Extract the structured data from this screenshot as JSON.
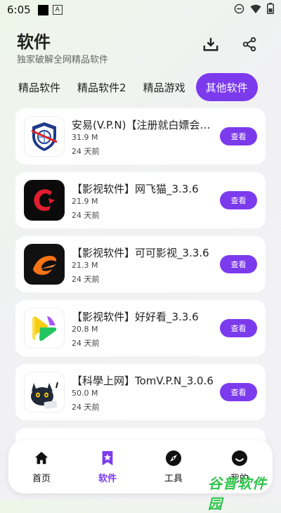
{
  "status": {
    "time": "6:05"
  },
  "header": {
    "title": "软件",
    "subtitle": "独家破解全网精品软件"
  },
  "tabs": [
    {
      "label": "精品软件"
    },
    {
      "label": "精品软件2"
    },
    {
      "label": "精品游戏"
    },
    {
      "label": "其他软件"
    }
  ],
  "apps": [
    {
      "name": "安易(V.P.N)【注册就白嫖会员】",
      "size": "31.9 M",
      "date": "24 天前",
      "button": "查看"
    },
    {
      "name": "【影视软件】网飞猫_3.3.6",
      "size": "21.9 M",
      "date": "24 天前",
      "button": "查看"
    },
    {
      "name": "【影视软件】可可影视_3.3.6",
      "size": "21.3 M",
      "date": "24 天前",
      "button": "查看"
    },
    {
      "name": "【影视软件】好好看_3.3.6",
      "size": "20.8 M",
      "date": "24 天前",
      "button": "查看"
    },
    {
      "name": "【科學上网】TomV.P.N_3.0.6",
      "size": "50.0 M",
      "date": "24 天前",
      "button": "查看"
    }
  ],
  "nav": [
    {
      "label": "首页"
    },
    {
      "label": "软件"
    },
    {
      "label": "工具"
    },
    {
      "label": "我的"
    }
  ],
  "colors": {
    "accent": "#7c3aed"
  },
  "icons": {
    "download": "download-icon",
    "share": "share-icon",
    "home": "home-icon",
    "software": "bookmark-star-icon",
    "tools": "compass-icon",
    "profile": "smile-icon"
  },
  "watermark": "谷普软件园"
}
